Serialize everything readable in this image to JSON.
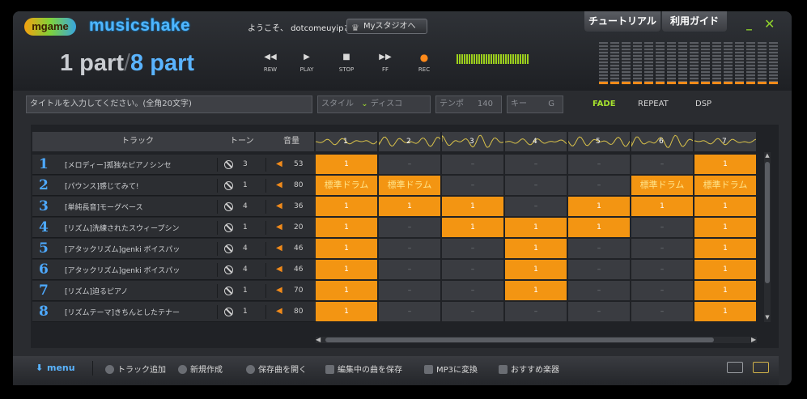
{
  "app": {
    "logo_text": "mgame",
    "title": "musicshake",
    "welcome": "ようこそ、 dotcomeuyipさん",
    "mystudio_label": "Myスタジオへ",
    "tabs": [
      "チュートリアル",
      "利用ガイド"
    ]
  },
  "part": {
    "current": "1 part",
    "total": "8 part",
    "slash": "/"
  },
  "transport": [
    {
      "symbol": "◀◀",
      "label": "REW"
    },
    {
      "symbol": "▶",
      "label": "PLAY"
    },
    {
      "symbol": "■",
      "label": "STOP"
    },
    {
      "symbol": "▶▶",
      "label": "FF"
    },
    {
      "symbol": "●",
      "label": "REC"
    }
  ],
  "fields": {
    "title_placeholder": "タイトルを入力してください。(全角20文字)",
    "style_label": "スタイル",
    "style_value": "ディスコ",
    "tempo_label": "テンポ",
    "tempo_value": "140",
    "key_label": "キー",
    "key_value": "G"
  },
  "modes": [
    "FADE",
    "REPEAT",
    "DSP"
  ],
  "columns": {
    "track": "トラック",
    "tone": "トーン",
    "volume": "音量"
  },
  "tracks": [
    {
      "num": "1",
      "name": "[メロディー]孤独なピアノシンセ",
      "tone": "3",
      "vol": "53"
    },
    {
      "num": "2",
      "name": "[パウンス]感じてみて!",
      "tone": "1",
      "vol": "80"
    },
    {
      "num": "3",
      "name": "[単純長音]モーグベース",
      "tone": "4",
      "vol": "36"
    },
    {
      "num": "4",
      "name": "[リズム]洗練されたスウィープシン",
      "tone": "1",
      "vol": "20"
    },
    {
      "num": "5",
      "name": "[アタックリズム]genki ボイスパッ",
      "tone": "4",
      "vol": "46"
    },
    {
      "num": "6",
      "name": "[アタックリズム]genki ボイスパッ",
      "tone": "4",
      "vol": "46"
    },
    {
      "num": "7",
      "name": "[リズム]迫るピアノ",
      "tone": "1",
      "vol": "70"
    },
    {
      "num": "8",
      "name": "[リズムテーマ]きちんとしたテナー",
      "tone": "1",
      "vol": "80"
    }
  ],
  "grid_columns": [
    "1",
    "2",
    "3",
    "4",
    "5",
    "6",
    "7"
  ],
  "grid": [
    [
      "1",
      "–",
      "–",
      "–",
      "–",
      "–",
      "1"
    ],
    [
      "標準ドラム",
      "標準ドラム",
      "–",
      "–",
      "–",
      "標準ドラム",
      "標準ドラム"
    ],
    [
      "1",
      "1",
      "1",
      "–",
      "1",
      "1",
      "1"
    ],
    [
      "1",
      "–",
      "1",
      "1",
      "1",
      "–",
      "1"
    ],
    [
      "1",
      "–",
      "–",
      "1",
      "–",
      "–",
      "1"
    ],
    [
      "1",
      "–",
      "–",
      "1",
      "–",
      "–",
      "1"
    ],
    [
      "1",
      "–",
      "–",
      "1",
      "–",
      "–",
      "1"
    ],
    [
      "1",
      "–",
      "–",
      "–",
      "–",
      "–",
      "1"
    ]
  ],
  "bottom": {
    "menu": "menu",
    "items": [
      "トラック追加",
      "新規作成",
      "保存曲を開く",
      "編集中の曲を保存",
      "MP3に変換",
      "おすすめ楽器"
    ]
  },
  "colors": {
    "accent_orange": "#f39512",
    "accent_blue": "#5ab4ff",
    "accent_green": "#a6e22e"
  }
}
